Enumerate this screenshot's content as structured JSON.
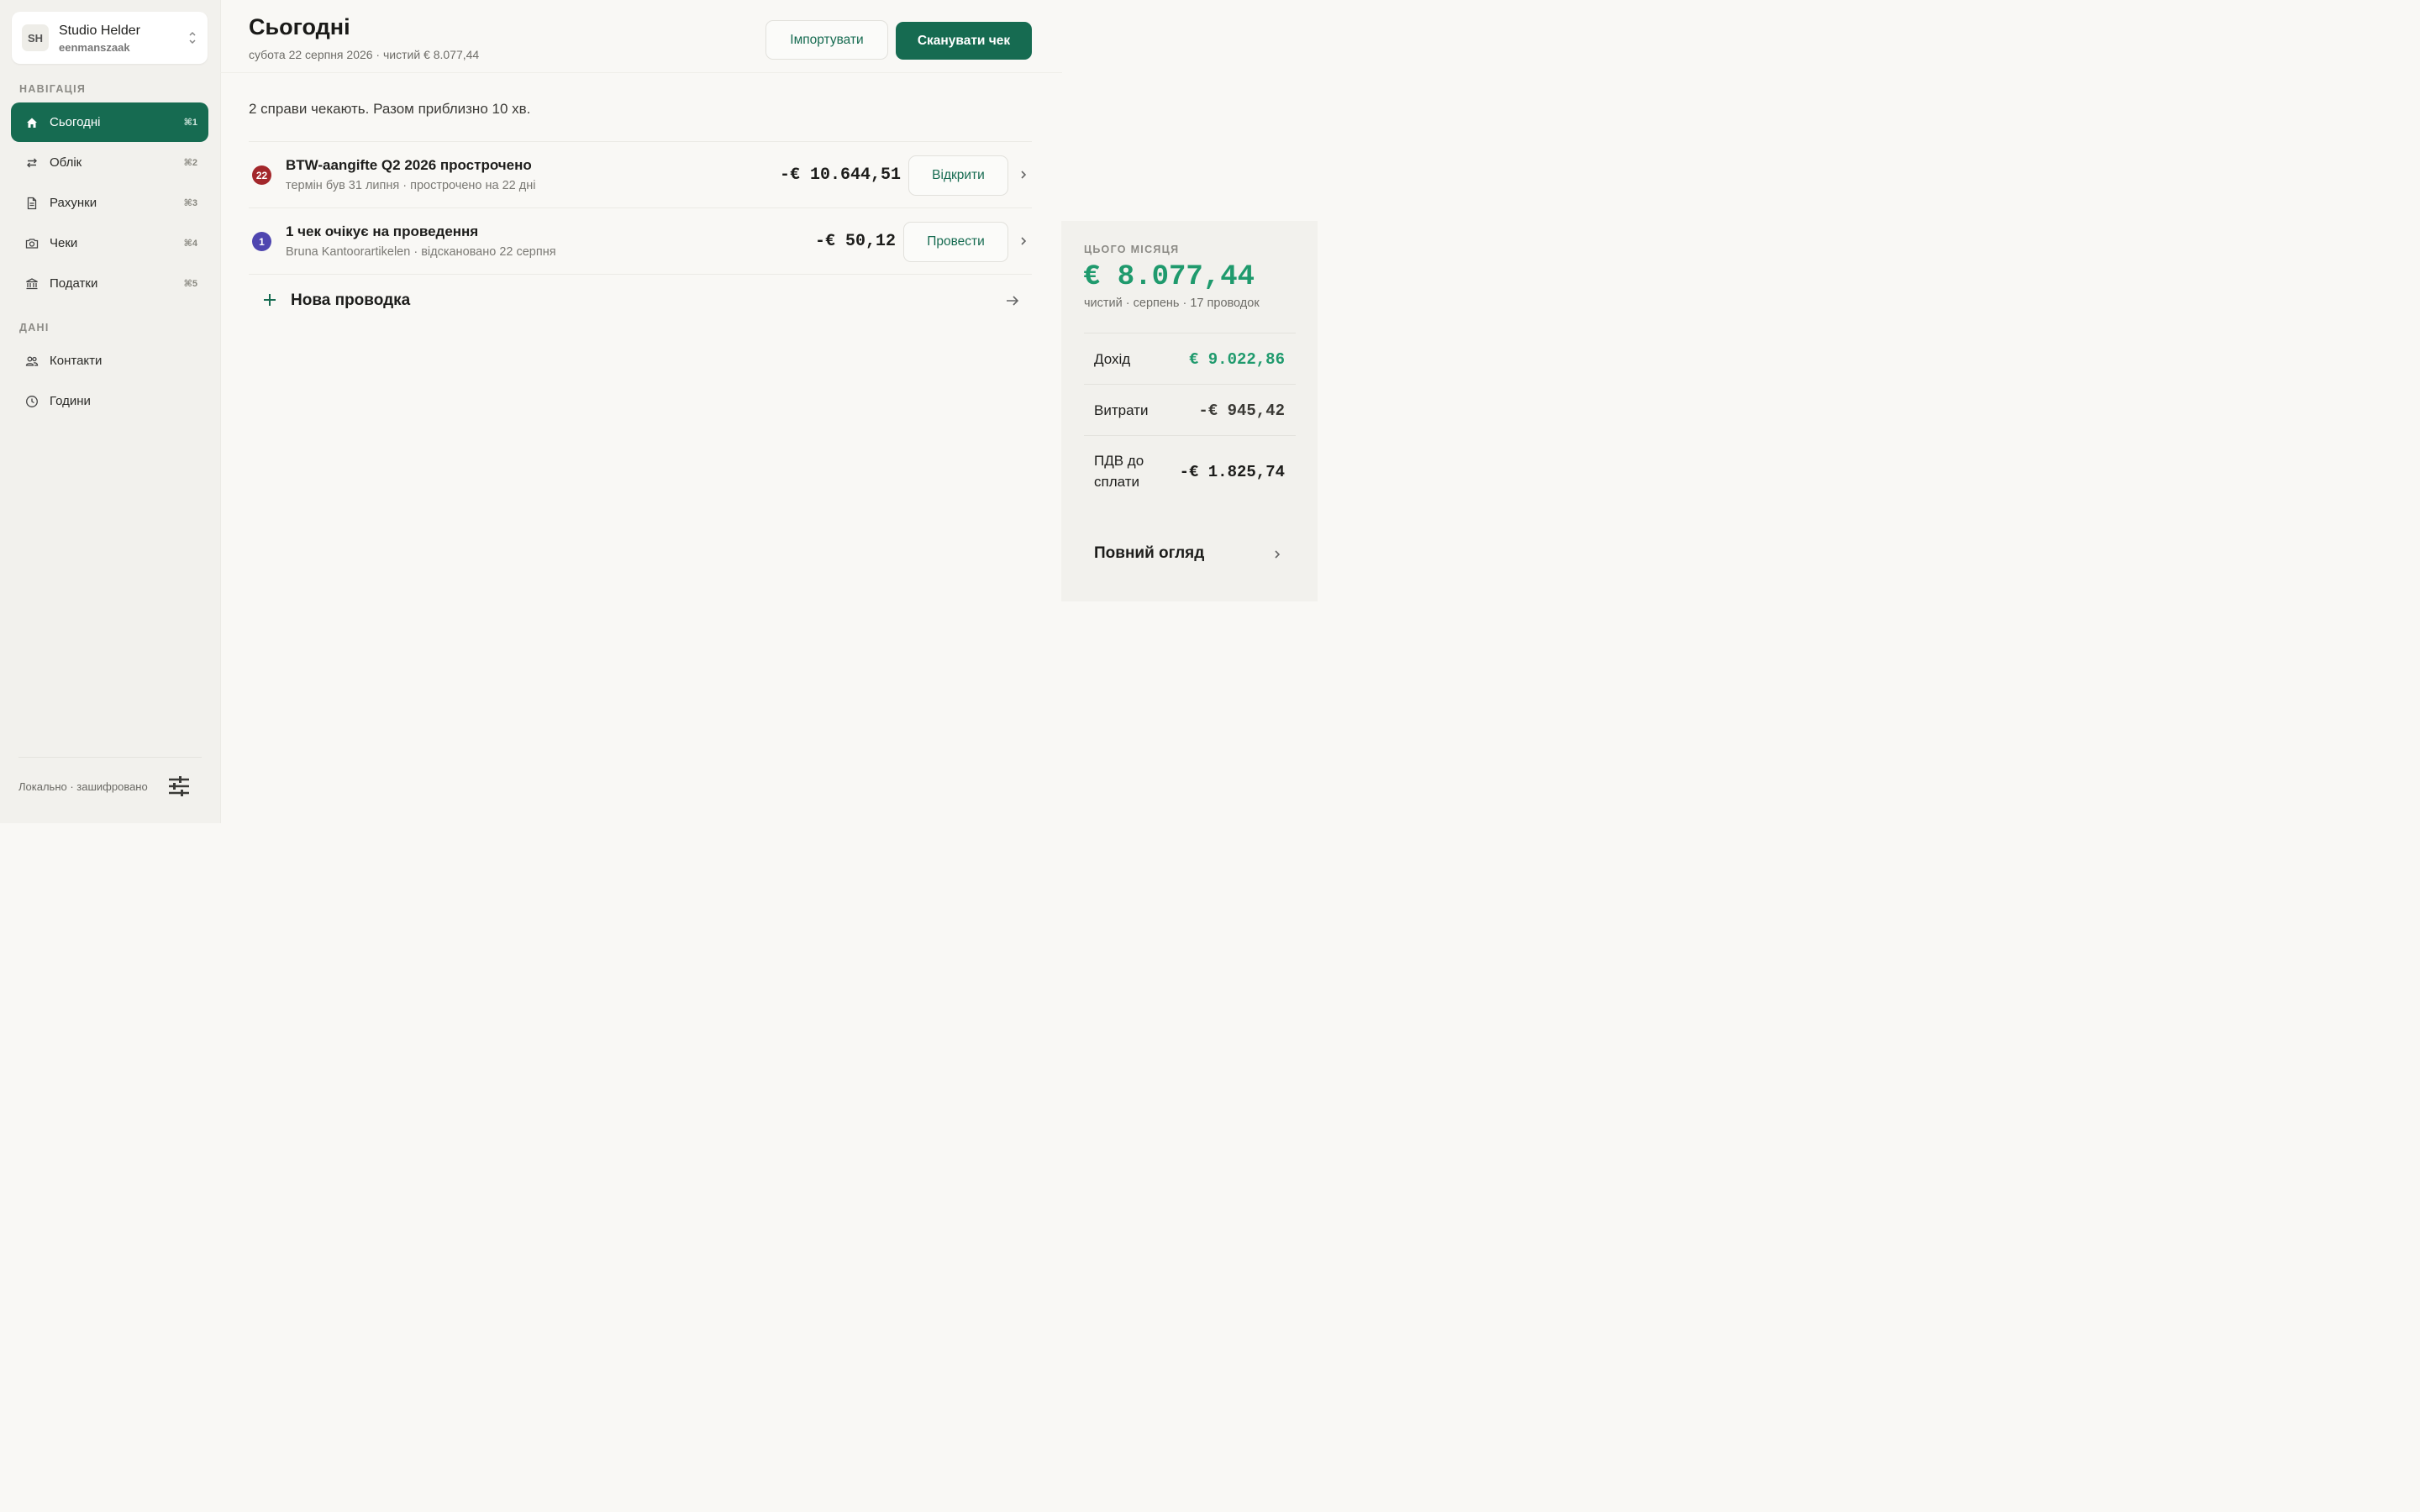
{
  "org": {
    "initials": "SH",
    "name": "Studio Helder",
    "type": "eenmanszaak"
  },
  "sidebar": {
    "nav_label": "НАВІГАЦІЯ",
    "nav": [
      {
        "label": "Сьогодні",
        "key": "⌘1",
        "icon": "home-icon",
        "active": true
      },
      {
        "label": "Облік",
        "key": "⌘2",
        "icon": "transfer-icon"
      },
      {
        "label": "Рахунки",
        "key": "⌘3",
        "icon": "document-icon"
      },
      {
        "label": "Чеки",
        "key": "⌘4",
        "icon": "camera-icon"
      },
      {
        "label": "Податки",
        "key": "⌘5",
        "icon": "bank-icon"
      }
    ],
    "data_label": "ДАНІ",
    "data_items": [
      {
        "label": "Контакти",
        "icon": "people-icon"
      },
      {
        "label": "Години",
        "icon": "clock-icon"
      }
    ],
    "footer_text": "Локально · зашифровано",
    "footer_icon": "sliders-icon"
  },
  "header": {
    "title": "Сьогодні",
    "subtitle": "субота 22 серпня 2026 · чистий € 8.077,44",
    "import_label": "Імпортувати",
    "scan_label": "Сканувати чек"
  },
  "summary": "2 справи чекають. Разом приблизно 10 хв.",
  "tasks": [
    {
      "badge": "22",
      "badge_color": "#a3272b",
      "title": "BTW-aangifte Q2 2026 прострочено",
      "sub": "термін був 31 липня · прострочено на 22 дні",
      "amount": "-€ 10.644,51",
      "action": "Відкрити"
    },
    {
      "badge": "1",
      "badge_color": "#4f46b0",
      "title": "1 чек очікує на проведення",
      "sub": "Bruna Kantoorartikelen · відскановано 22 серпня",
      "amount": "-€ 50,12",
      "action": "Провести"
    }
  ],
  "new_entry": "Нова проводка",
  "panel": {
    "caption": "ЦЬОГО МІСЯЦЯ",
    "net": "€ 8.077,44",
    "meta": "чистий · серпень · 17 проводок",
    "rows": [
      {
        "label": "Дохід",
        "value": "€ 9.022,86",
        "color": "#1f9a6d"
      },
      {
        "label": "Витрати",
        "value": "-€ 945,42",
        "color": "#3b3a36"
      },
      {
        "label": "ПДВ до сплати",
        "value": "-€ 1.825,74",
        "color": "#1d1d1b"
      }
    ],
    "full_label": "Повний огляд"
  },
  "colors": {
    "accent": "#166b51",
    "positive": "#1f9a6d",
    "overdue": "#a3272b",
    "info": "#4f46b0"
  }
}
